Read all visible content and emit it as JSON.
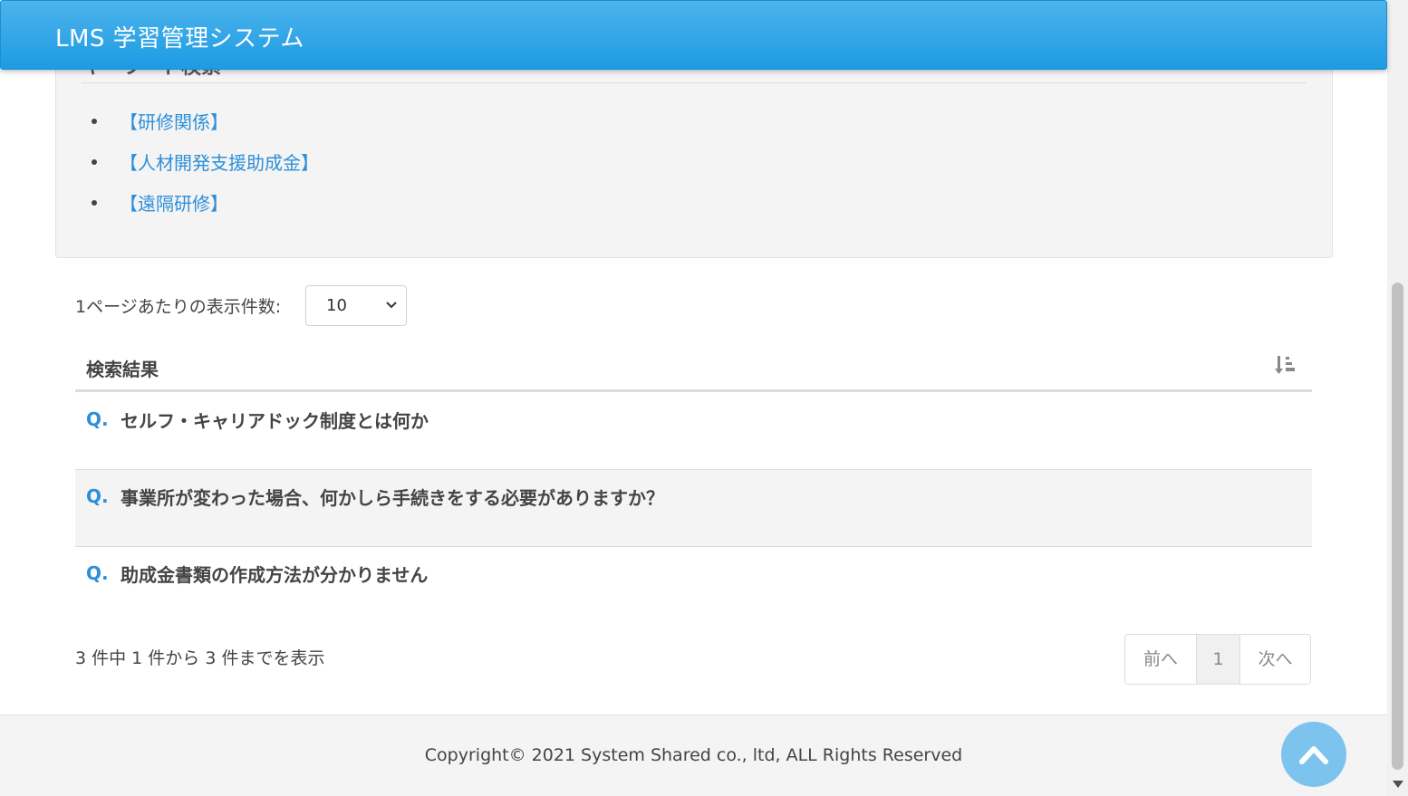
{
  "header": {
    "title": "LMS 学習管理システム"
  },
  "keyword_panel": {
    "heading": "キーワード検索",
    "items": [
      {
        "label": "【研修関係】"
      },
      {
        "label": "【人材開発支援助成金】"
      },
      {
        "label": "【遠隔研修】"
      }
    ]
  },
  "page_size": {
    "label": "1ページあたりの表示件数:",
    "value": "10"
  },
  "results": {
    "title": "検索結果",
    "sort_icon": "sort-amount-down-icon",
    "rows": [
      {
        "q": "Q.",
        "text": "セルフ・キャリアドック制度とは何か"
      },
      {
        "q": "Q.",
        "text": "事業所が変わった場合、何かしら手続きをする必要がありますか？"
      },
      {
        "q": "Q.",
        "text": "助成金書類の作成方法が分かりません"
      }
    ]
  },
  "pagination": {
    "info": "3 件中 1 件から 3 件までを表示",
    "prev": "前へ",
    "current": "1",
    "next": "次へ"
  },
  "footer": {
    "copyright": "Copyright© 2021 System Shared co., ltd, ALL Rights Reserved"
  },
  "back_to_top": {
    "icon": "chevron-up-icon"
  },
  "colors": {
    "header": "#1e9be3",
    "link": "#2d8fd8",
    "back_to_top": "#7cc3ee"
  }
}
